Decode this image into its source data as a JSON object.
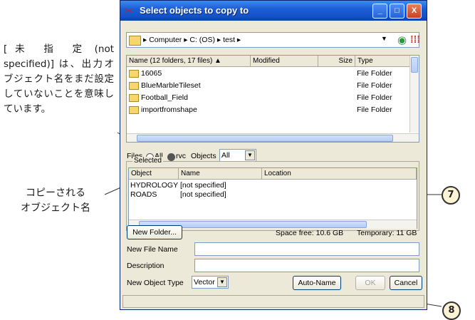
{
  "annotations": {
    "note_unspecified": "[ 未　指　定 (not specified)] は、出力オブジェクト名をまだ設定していないことを意味しています。",
    "note_copied": "コピーされる\nオブジェクト名",
    "callout_7": "7",
    "callout_8": "8"
  },
  "window": {
    "title": "Select objects to copy to",
    "controls": {
      "minimize": "_",
      "maximize": "□",
      "close": "X"
    }
  },
  "address": {
    "path": "▸ Computer ▸ C: (OS) ▸ test ▸"
  },
  "file_list": {
    "columns": [
      "Name (12 folders, 17 files) ▲",
      "Modified",
      "Size",
      "Type"
    ],
    "rows": [
      {
        "name": "16065",
        "type": "File Folder"
      },
      {
        "name": "BlueMarbleTileset",
        "type": "File Folder"
      },
      {
        "name": "Football_Field",
        "type": "File Folder"
      },
      {
        "name": "importfromshape",
        "type": "File Folder"
      }
    ]
  },
  "filters": {
    "files_label": "Files",
    "all_label": "All",
    "rvc_label": "rvc",
    "objects_label": "Objects",
    "objects_value": "All"
  },
  "selected": {
    "legend": "Selected",
    "columns": [
      "Object",
      "Name",
      "Location"
    ],
    "rows": [
      {
        "object": "HYDROLOGY",
        "name": "[not specified]"
      },
      {
        "object": "ROADS",
        "name": "[not specified]"
      }
    ]
  },
  "bottom": {
    "new_folder": "New Folder...",
    "space_free": "Space free: 10.6 GB",
    "temporary": "Temporary: 11 GB",
    "new_file_name_label": "New File Name",
    "description_label": "Description",
    "new_object_type_label": "New Object Type",
    "new_object_type_value": "Vector",
    "auto_name": "Auto-Name",
    "ok": "OK",
    "cancel": "Cancel"
  }
}
